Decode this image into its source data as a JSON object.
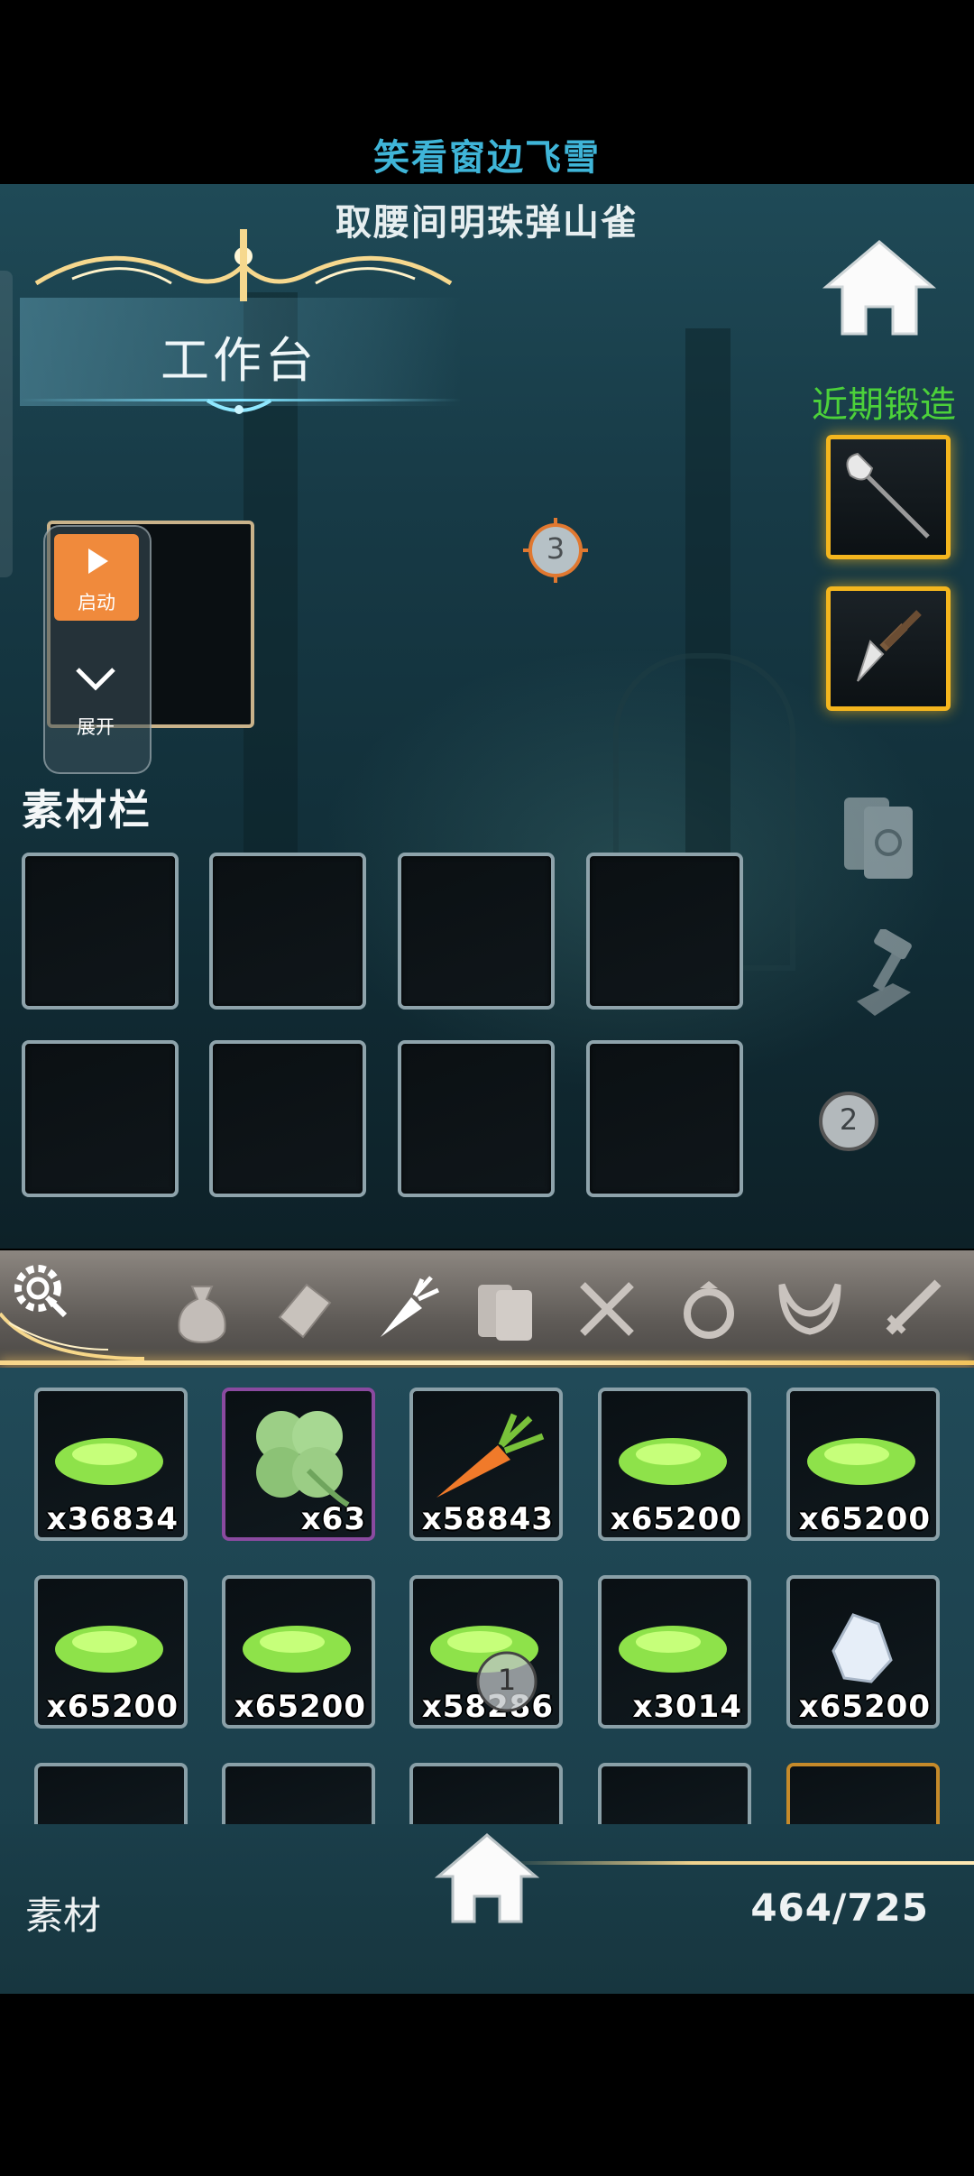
{
  "header": {
    "user_name": "笑看窗边飞雪",
    "subtitle": "取腰间明珠弹山雀"
  },
  "workbench": {
    "title": "工作台",
    "start_label": "启动",
    "expand_label": "展开",
    "queue_badge": "3"
  },
  "recent": {
    "title": "近期锻造",
    "items": [
      "battle-axe-icon",
      "dagger-icon"
    ]
  },
  "materials": {
    "title": "素材栏",
    "slots_count_label": "",
    "side_badge": "2"
  },
  "tabs": [
    {
      "icon": "bag-icon"
    },
    {
      "icon": "scroll-icon"
    },
    {
      "icon": "carrot-icon",
      "selected": true
    },
    {
      "icon": "book-icon"
    },
    {
      "icon": "tools-icon"
    },
    {
      "icon": "ring-icon"
    },
    {
      "icon": "horns-icon"
    },
    {
      "icon": "sword-icon"
    }
  ],
  "inventory": {
    "rows": [
      [
        {
          "icon": "green-slime-icon",
          "qty": "x36834"
        },
        {
          "icon": "clover-icon",
          "qty": "x63",
          "rarity": "purple"
        },
        {
          "icon": "carrot-icon",
          "qty": "x58843"
        },
        {
          "icon": "green-slime-icon",
          "qty": "x65200"
        },
        {
          "icon": "green-slime-icon",
          "qty": "x65200"
        }
      ],
      [
        {
          "icon": "green-slime-icon",
          "qty": "x65200"
        },
        {
          "icon": "green-slime-icon",
          "qty": "x65200"
        },
        {
          "icon": "green-slime-icon",
          "qty": "x58286"
        },
        {
          "icon": "green-slime-icon",
          "qty": "x3014"
        },
        {
          "icon": "crystal-icon",
          "qty": "x65200"
        }
      ]
    ],
    "overlay_badge": "1"
  },
  "footer": {
    "label": "素材",
    "count": "464/725"
  },
  "colors": {
    "user_name": "#3fb5d8",
    "recent_title": "#4cd13a",
    "start_button": "#f08a3c",
    "recent_border": "#f4b61e"
  }
}
